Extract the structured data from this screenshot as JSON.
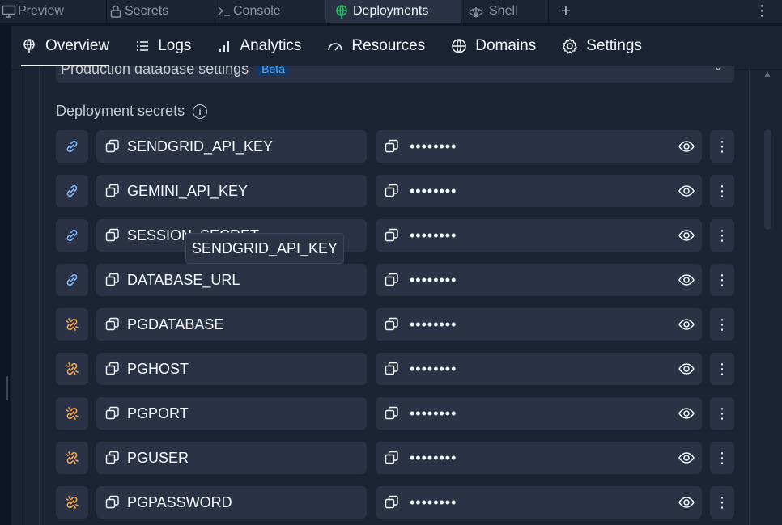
{
  "tabs": [
    {
      "label": "Preview",
      "icon": "monitor-icon",
      "active": false
    },
    {
      "label": "Secrets",
      "icon": "lock-icon",
      "active": false
    },
    {
      "label": "Console",
      "icon": "terminal-icon",
      "active": false
    },
    {
      "label": "Deployments",
      "icon": "deployments-icon",
      "active": true
    },
    {
      "label": "Shell",
      "icon": "shell-icon",
      "active": false
    }
  ],
  "tab_add": "+",
  "tab_menu": "⋮",
  "subnav": {
    "overview": "Overview",
    "logs": "Logs",
    "analytics": "Analytics",
    "resources": "Resources",
    "domains": "Domains",
    "settings": "Settings",
    "active": "Overview"
  },
  "db_settings": {
    "label": "Production database settings",
    "badge": "Beta"
  },
  "section_title": "Deployment secrets",
  "secrets": [
    {
      "key": "SENDGRID_API_KEY",
      "value": "••••••••",
      "linked": true
    },
    {
      "key": "GEMINI_API_KEY",
      "value": "••••••••",
      "linked": true
    },
    {
      "key": "SESSION_SECRET",
      "value": "••••••••",
      "linked": true
    },
    {
      "key": "DATABASE_URL",
      "value": "••••••••",
      "linked": true
    },
    {
      "key": "PGDATABASE",
      "value": "••••••••",
      "linked": false
    },
    {
      "key": "PGHOST",
      "value": "••••••••",
      "linked": false
    },
    {
      "key": "PGPORT",
      "value": "••••••••",
      "linked": false
    },
    {
      "key": "PGUSER",
      "value": "••••••••",
      "linked": false
    },
    {
      "key": "PGPASSWORD",
      "value": "••••••••",
      "linked": false
    }
  ],
  "tooltip": "SENDGRID_API_KEY",
  "colors": {
    "linked": "#7fb6ff",
    "unlinked": "#f5a64b",
    "deploy_accent": "#2fc26b"
  }
}
